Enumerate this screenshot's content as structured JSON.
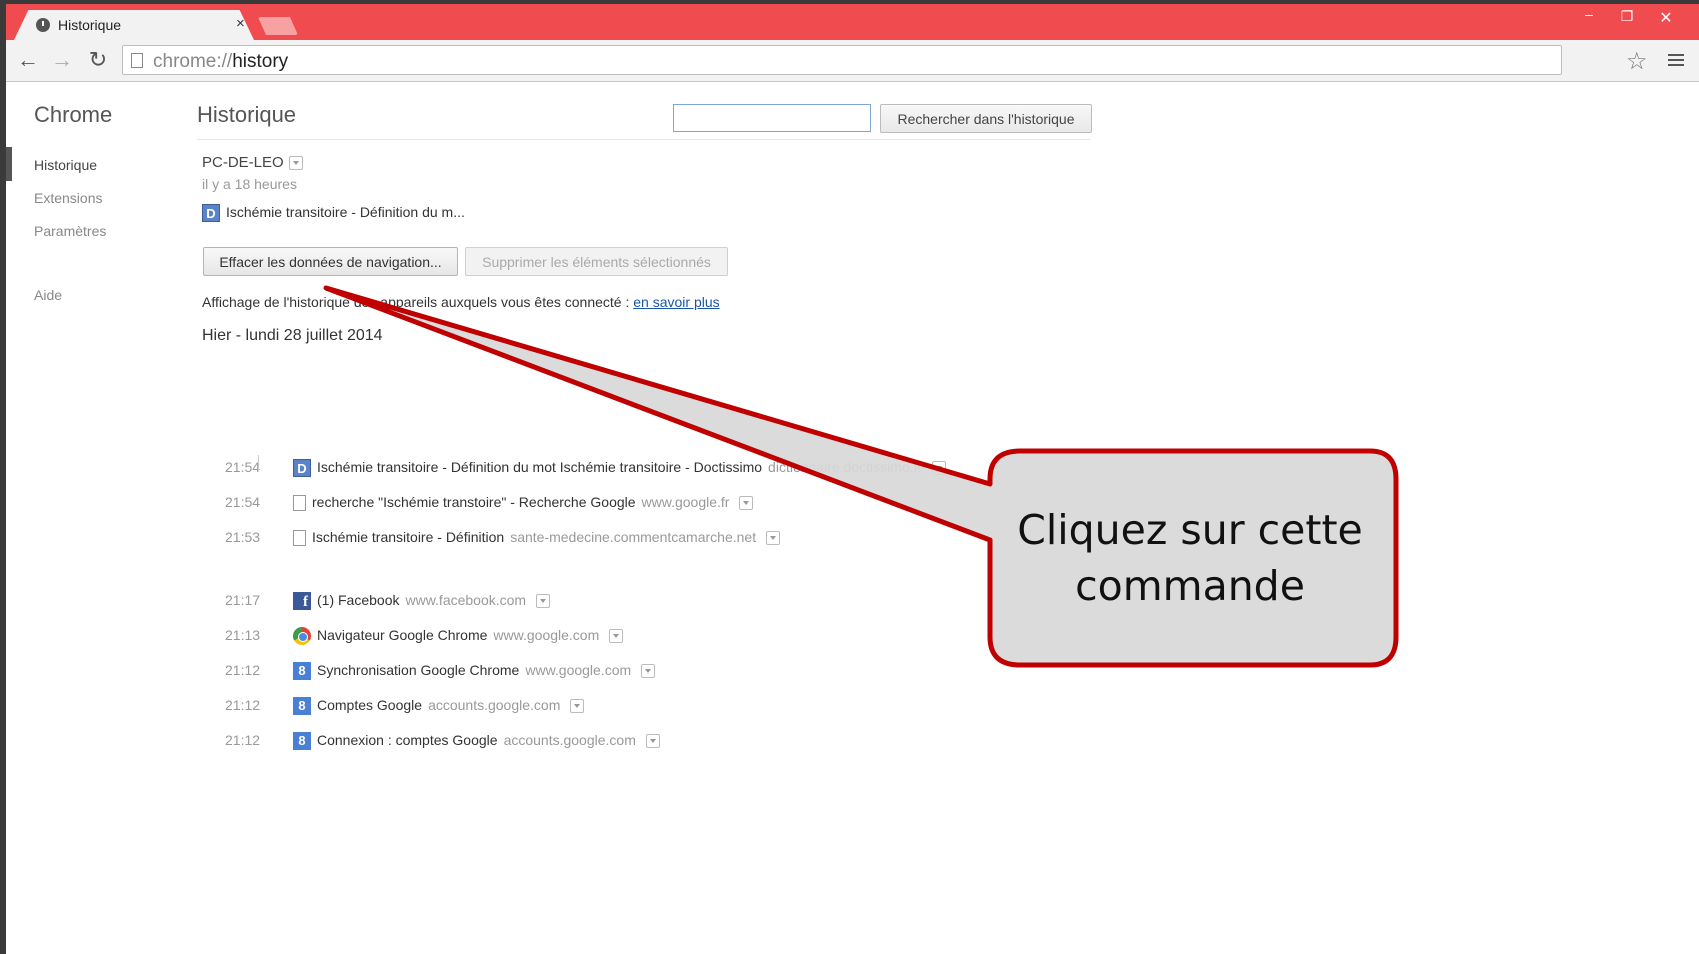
{
  "browser": {
    "tab_title": "Historique",
    "tab_close": "×",
    "url_scheme": "chrome://",
    "url_path": "history",
    "window_buttons": {
      "minimize": "–",
      "maximize": "❐",
      "close": "✕"
    }
  },
  "sidebar": {
    "brand": "Chrome",
    "items": [
      {
        "label": "Historique",
        "selected": true
      },
      {
        "label": "Extensions"
      },
      {
        "label": "Paramètres"
      },
      {
        "label": "Aide"
      }
    ]
  },
  "header": {
    "title": "Historique",
    "search_placeholder": "",
    "search_button": "Rechercher dans l'historique"
  },
  "device": {
    "name": "PC-DE-LEO",
    "time": "il y a 18 heures",
    "item": "Ischémie transitoire - Définition du m..."
  },
  "actions": {
    "clear_button": "Effacer les données de navigation...",
    "delete_button": "Supprimer les éléments sélectionnés"
  },
  "info": {
    "text": "Affichage de l'historique des appareils auxquels vous êtes connecté : ",
    "link": "en savoir plus"
  },
  "day_header": "Hier - lundi 28 juillet 2014",
  "history": [
    {
      "time": "21:54",
      "icon": "doctissimo-icon",
      "title": "Ischémie transitoire - Définition du mot Ischémie transitoire - Doctissimo",
      "domain": "dictionnaire.doctissimo.fr"
    },
    {
      "time": "21:54",
      "icon": "page-icon",
      "title": "recherche \"Ischémie transtoire\" - Recherche Google",
      "domain": "www.google.fr"
    },
    {
      "time": "21:53",
      "icon": "page-icon",
      "title": "Ischémie transitoire - Définition",
      "domain": "sante-medecine.commentcamarche.net"
    },
    {
      "time": "21:17",
      "icon": "facebook-icon",
      "title": "(1) Facebook",
      "domain": "www.facebook.com"
    },
    {
      "time": "21:13",
      "icon": "chrome-icon",
      "title": "Navigateur Google Chrome",
      "domain": "www.google.com"
    },
    {
      "time": "21:12",
      "icon": "google-icon",
      "title": "Synchronisation Google Chrome",
      "domain": "www.google.com"
    },
    {
      "time": "21:12",
      "icon": "google-icon",
      "title": "Comptes Google",
      "domain": "accounts.google.com"
    },
    {
      "time": "21:12",
      "icon": "google-icon",
      "title": "Connexion : comptes Google",
      "domain": "accounts.google.com"
    }
  ],
  "callout": {
    "line1": "Cliquez sur cette",
    "line2": "commande",
    "border_color": "#c00000",
    "fill_color": "#d8d8d8"
  },
  "colors": {
    "titlebar": "#f04b4e",
    "link": "#1a56a8"
  }
}
